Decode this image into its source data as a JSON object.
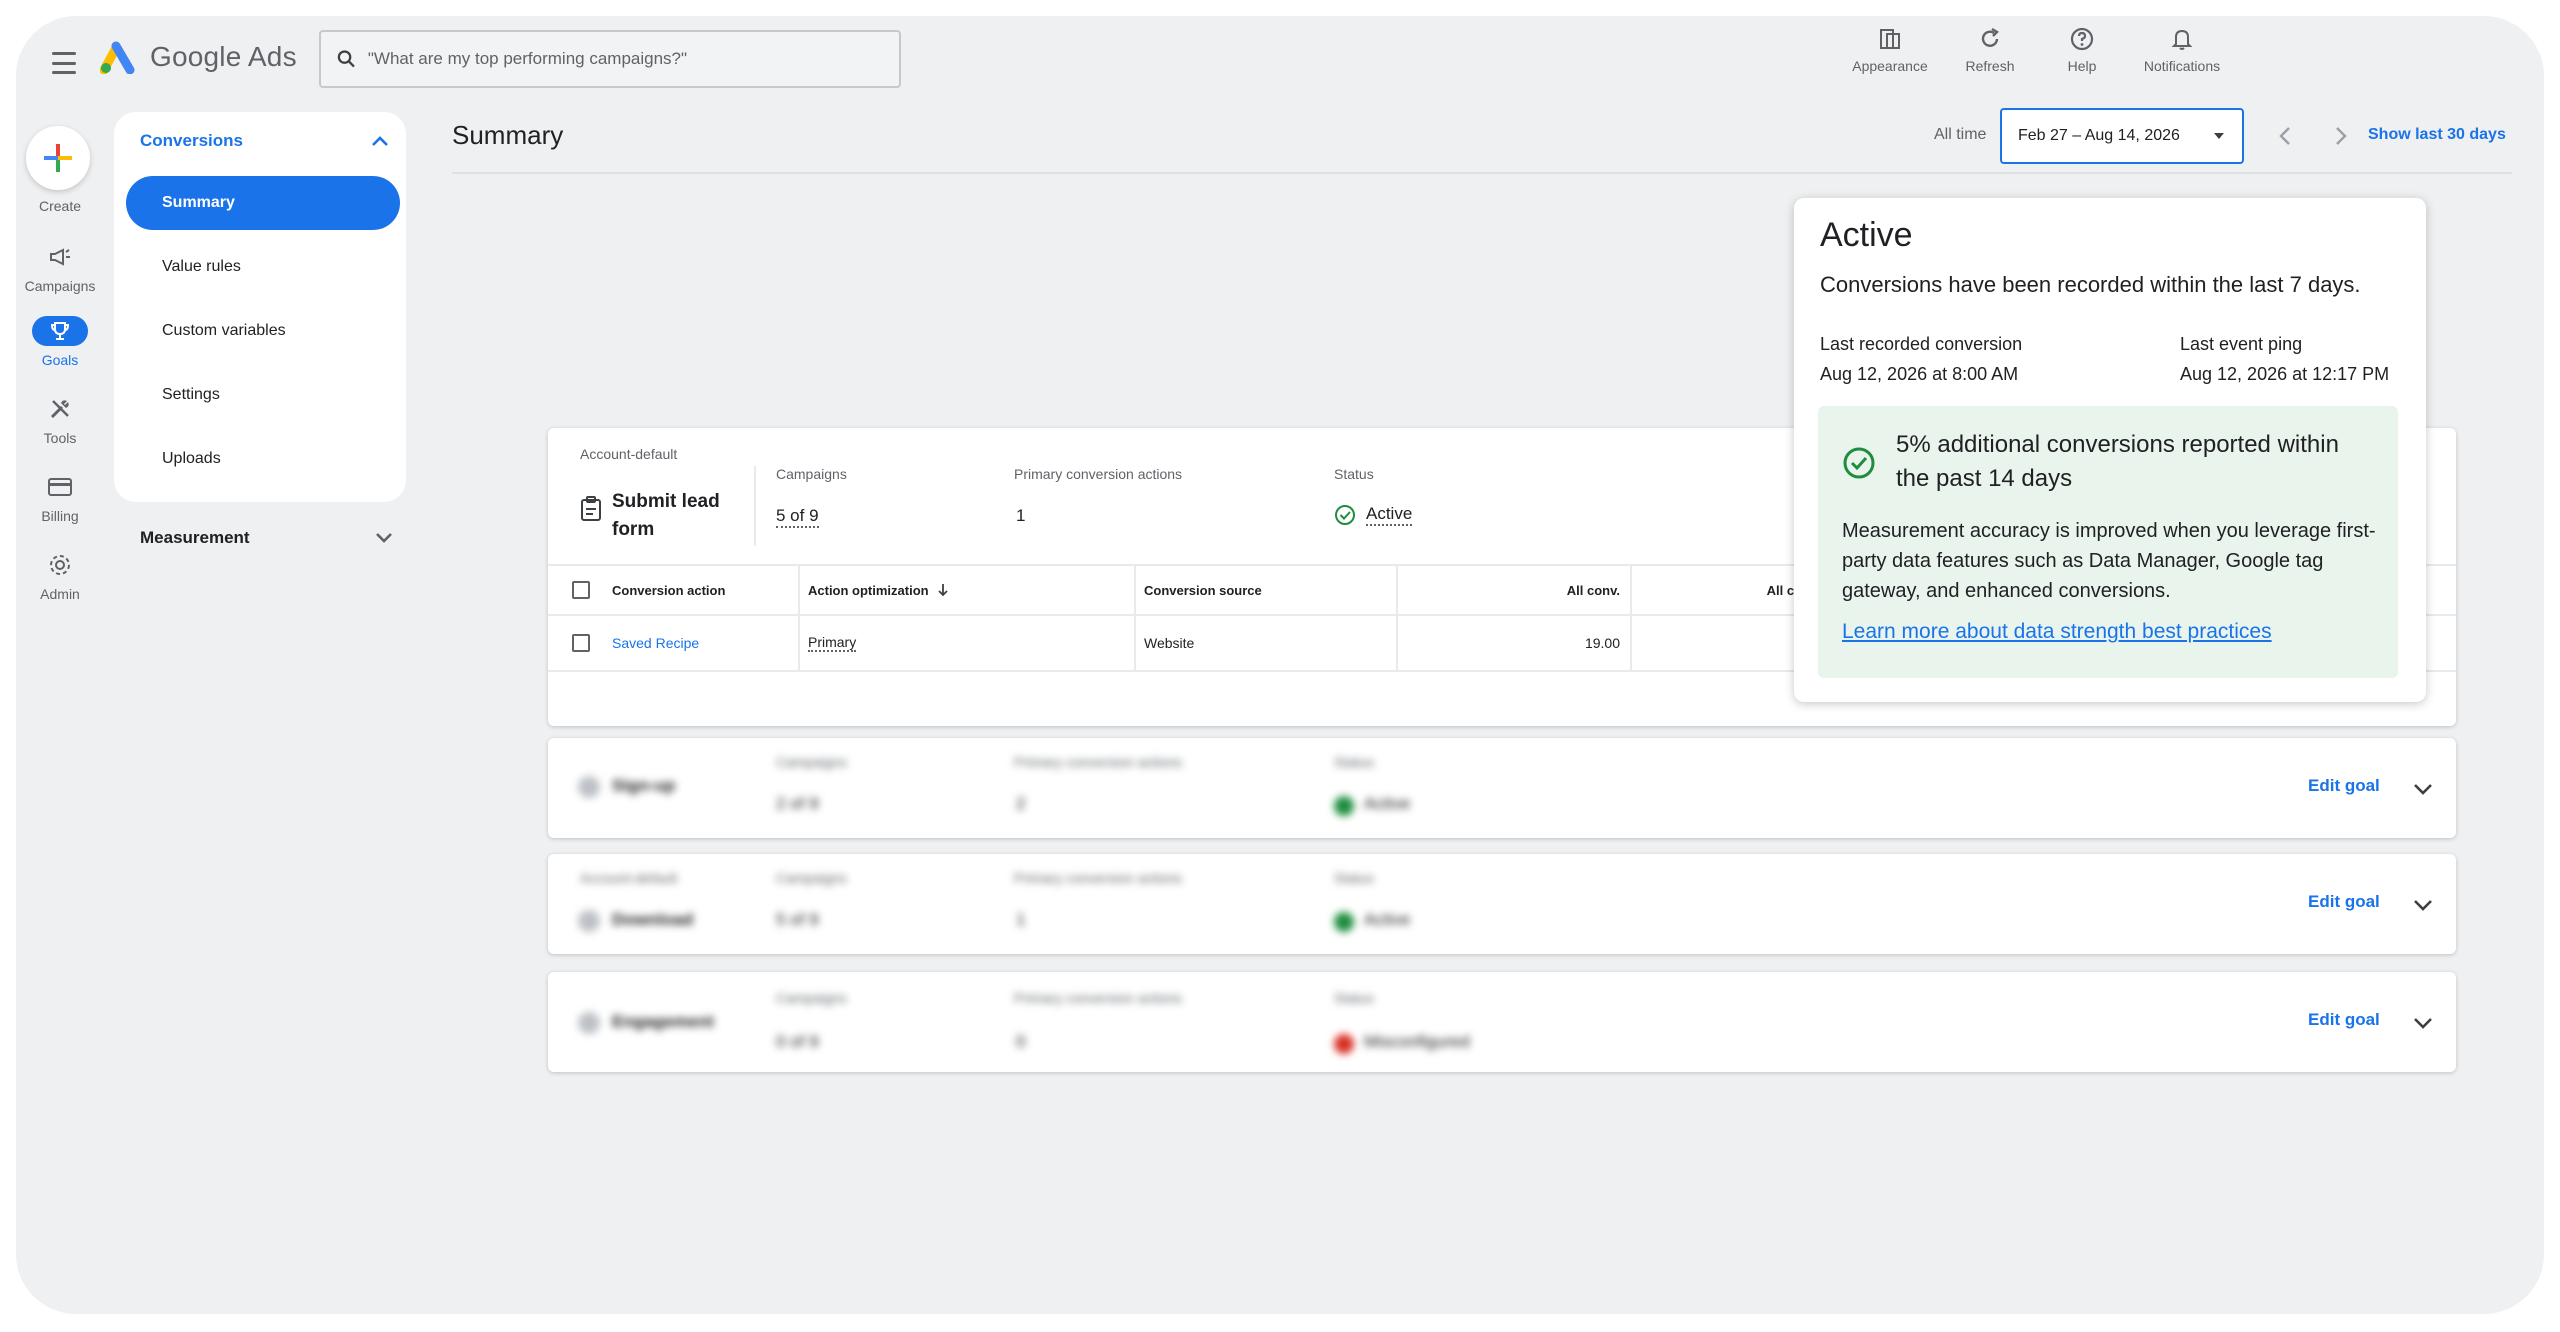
{
  "app": {
    "name": "Google Ads"
  },
  "search": {
    "placeholder": "\"What are my top performing campaigns?\""
  },
  "top_actions": [
    {
      "label": "Appearance",
      "icon": "appearance-icon"
    },
    {
      "label": "Refresh",
      "icon": "refresh-icon"
    },
    {
      "label": "Help",
      "icon": "help-icon"
    },
    {
      "label": "Notifications",
      "icon": "bell-icon"
    }
  ],
  "rail": {
    "create": "Create",
    "items": [
      {
        "label": "Campaigns",
        "icon": "megaphone-icon"
      },
      {
        "label": "Goals",
        "icon": "trophy-icon",
        "active": true
      },
      {
        "label": "Tools",
        "icon": "tools-icon"
      },
      {
        "label": "Billing",
        "icon": "credit-card-icon"
      },
      {
        "label": "Admin",
        "icon": "gear-icon"
      }
    ]
  },
  "side_panel": {
    "section": "Conversions",
    "items": [
      "Summary",
      "Value rules",
      "Custom variables",
      "Settings",
      "Uploads"
    ],
    "active": "Summary",
    "measurement": "Measurement"
  },
  "header": {
    "title": "Summary",
    "all_time": "All time",
    "date_range": "Feb 27 – Aug 14, 2026",
    "show_last": "Show last 30 days"
  },
  "goal": {
    "tag": "Account-default",
    "name": "Submit lead form",
    "campaigns_label": "Campaigns",
    "campaigns_value": "5 of 9",
    "primary_label": "Primary conversion actions",
    "primary_value": "1",
    "status_label": "Status",
    "status_value": "Active",
    "table": {
      "headers": [
        "Conversion action",
        "Action optimization",
        "Conversion source",
        "All conv.",
        "All con"
      ],
      "rows": [
        {
          "action": "Saved Recipe",
          "optimization": "Primary",
          "source": "Website",
          "all_conv": "19.00"
        }
      ]
    }
  },
  "collapsed_goals": [
    {
      "tag": "",
      "name": "Sign-up",
      "campaigns_label": "Campaigns",
      "campaigns": "2 of 9",
      "primary_label": "Primary conversion actions",
      "primary": "2",
      "status_label": "Status",
      "status": "Active",
      "edit": "Edit goal"
    },
    {
      "tag": "Account-default",
      "name": "Download",
      "campaigns_label": "Campaigns",
      "campaigns": "5 of 9",
      "primary_label": "Primary conversion actions",
      "primary": "1",
      "status_label": "Status",
      "status": "Active",
      "edit": "Edit goal"
    },
    {
      "tag": "",
      "name": "Engagement",
      "campaigns_label": "Campaigns",
      "campaigns": "0 of 9",
      "primary_label": "Primary conversion actions",
      "primary": "0",
      "status_label": "Status",
      "status": "Misconfigured",
      "edit": "Edit goal"
    }
  ],
  "popover": {
    "title": "Active",
    "description": "Conversions have been recorded within the last 7 days.",
    "last_conv_label": "Last recorded conversion",
    "last_conv_value": "Aug 12, 2026 at 8:00 AM",
    "last_ping_label": "Last event ping",
    "last_ping_value": "Aug 12, 2026 at 12:17 PM",
    "box_head": "5% additional conversions reported within the past 14 days",
    "box_body": "Measurement accuracy is improved when you leverage first-party data features such as Data Manager, Google tag gateway, and enhanced conversions.",
    "box_link": "Learn more about data strength best practices"
  },
  "colors": {
    "accent": "#1a73e8",
    "success": "#1e8e3e",
    "error": "#d93025",
    "success_bg": "#e9f4ec"
  }
}
